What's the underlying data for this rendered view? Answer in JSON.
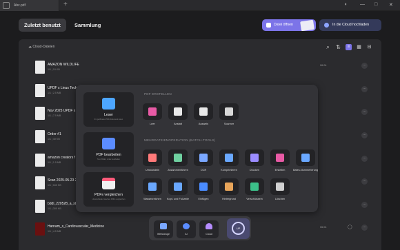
{
  "titlebar": {
    "tab_title": "Abc.pdf",
    "new_tab": "+",
    "min": "—",
    "max": "□",
    "close": "✕"
  },
  "topnav": {
    "tab_recent": "Zuletzt benutzt",
    "tab_collection": "Sammlung",
    "open_file": "Datei öffnen",
    "upload_cloud": "In die Cloud hochladen"
  },
  "panel": {
    "location": "Cloud-Dateien"
  },
  "files": [
    {
      "name": "AMAZON WILDLIFE",
      "meta": "1/1 | 10 KB",
      "date": "06.04",
      "dark": false
    },
    {
      "name": "UPDF x Linus Tech Tip",
      "meta": "1/1 | 2.5 MB",
      "date": "",
      "dark": false
    },
    {
      "name": "Nov 2025 UPDF x Li",
      "meta": "1/1 | 7.5 MB",
      "date": "",
      "dark": false
    },
    {
      "name": "Order #1",
      "meta": "1/1 | 40 KB",
      "date": "",
      "dark": false
    },
    {
      "name": "amazon creators f",
      "meta": "1/1 | 1.5 MB",
      "date": "",
      "dark": false
    },
    {
      "name": "Scan 2025-05-23 2",
      "meta": "1/1 | 160 KB",
      "date": "",
      "dark": false
    },
    {
      "name": "bddl_220528_a_stat",
      "meta": "1/1 | 300 KB",
      "date": "",
      "dark": false
    },
    {
      "name": "Harnam_s_Cardiovascular_Medicine",
      "meta": "1/1 | 4.5 MB",
      "date": "06.04",
      "dark": true
    }
  ],
  "overlay": {
    "left_cards": [
      {
        "title": "Leser",
        "sub": "Ihr geöffnetes PDF-Dokument lesen",
        "color": "#4da6ff"
      },
      {
        "title": "PDF bearbeiten",
        "sub": "Text, Bilder, Links bearbeiten",
        "color": "#5b8cff"
      },
      {
        "title": "PDFs vergleichen",
        "sub": "Unterschiede zwischen PDFs vergleichen",
        "color": "#ff5a7a"
      }
    ],
    "create_title": "PDF ERSTELLEN",
    "create_tools": [
      {
        "label": "Leer",
        "color": "#e85aa5"
      },
      {
        "label": "Anstatt",
        "color": "#e8e8e8"
      },
      {
        "label": "Ausweis",
        "color": "#e8e8e8"
      },
      {
        "label": "Scanner",
        "color": "#d8d8d8"
      }
    ],
    "batch_title": "MEHRDATEIENOPERATION (BATCH-TOOLS)",
    "batch_row1": [
      {
        "label": "Umwandeln",
        "color": "#ff7a7a"
      },
      {
        "label": "Zusammenführen",
        "color": "#6fd0a0"
      },
      {
        "label": "OCR",
        "color": "#7aa7ff"
      },
      {
        "label": "Komprimieren",
        "color": "#6aa8ff"
      },
      {
        "label": "Drucken",
        "color": "#9b8cff"
      },
      {
        "label": "Erstellen",
        "color": "#e85aa5"
      },
      {
        "label": "Bates-Nummerierung",
        "color": "#6aa8ff"
      }
    ],
    "batch_row2": [
      {
        "label": "Wasserzeichen",
        "color": "#6aa8ff"
      },
      {
        "label": "Kopf- und Fußzeile",
        "color": "#6aa8ff"
      },
      {
        "label": "Einfügen",
        "color": "#4a8cff"
      },
      {
        "label": "Hintergrund",
        "color": "#e8a55a"
      },
      {
        "label": "Verschlüsseln",
        "color": "#3cc08a"
      },
      {
        "label": "Löschen",
        "color": "#cfcfcf"
      }
    ]
  },
  "dock": {
    "items": [
      {
        "label": "Werkzeuge",
        "color": "#7aa7ff"
      },
      {
        "label": "AI",
        "color": "#5a8cff"
      },
      {
        "label": "Cloud",
        "color": "#b58cff"
      }
    ],
    "logo_text": "UP"
  }
}
